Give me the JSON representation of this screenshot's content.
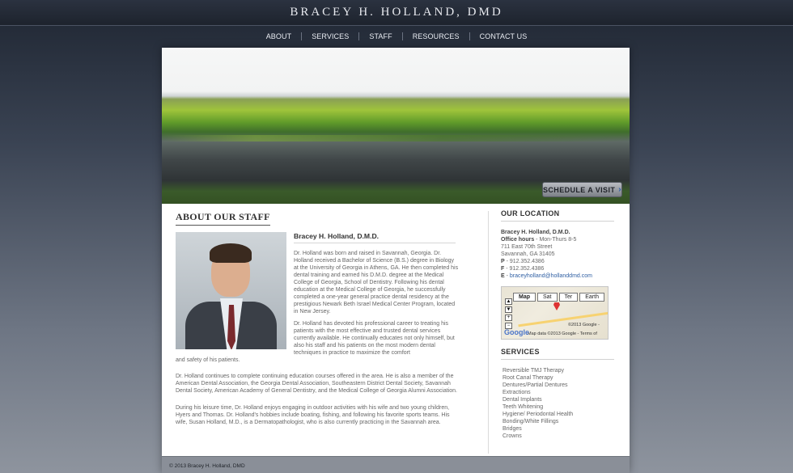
{
  "header": {
    "title": "BRACEY H. HOLLAND, DMD"
  },
  "nav": {
    "items": [
      "ABOUT",
      "SERVICES",
      "STAFF",
      "RESOURCES",
      "CONTACT US"
    ]
  },
  "hero": {
    "schedule_label": "SCHEDULE A VISIT"
  },
  "about": {
    "section_title": "ABOUT OUR STAFF",
    "doctor_name": "Bracey H. Holland, D.M.D.",
    "bio1": "Dr. Holland was born and raised in Savannah, Georgia. Dr. Holland received a Bachelor of Science (B.S.) degree in Biology at the University of Georgia in Athens, GA. He then completed his dental training and earned his D.M.D. degree at the Medical College of Georgia, School of Dentistry. Following his dental education at the Medical College of Georgia, he successfully completed a one-year general practice dental residency at the prestigious Newark Beth Israel Medical Center Program, located in New Jersey.",
    "bio2": "Dr. Holland has devoted his professional career to treating his patients with the most effective and trusted dental services currently available. He continually educates not only himself, but also his staff and his patients on the most modern dental techniques in practice to maximize the comfort",
    "bio2_tail": "and safety of his patients.",
    "bio3": "Dr. Holland continues to complete continuing education courses offered in the area. He is also a member of the American Dental Association, the Georgia Dental Association, Southeastern District Dental Society, Savannah Dental Society, American Academy of General Dentistry, and the Medical College of Georgia Alumni Association.",
    "bio4": "During his leisure time, Dr. Holland enjoys engaging in outdoor activities with his wife and two young children, Hyers and Thomas. Dr. Holland's hobbies include boating, fishing, and following his favorite sports teams. His wife, Susan Holland, M.D., is a Dermatopathologist, who is also currently practicing in the Savannah area."
  },
  "location": {
    "title": "OUR LOCATION",
    "name": "Bracey H. Holland, D.M.D.",
    "hours_label": "Office hours",
    "hours_value": " - Mon-Thurs 8-5",
    "street": "711 East 70th Street",
    "city": "Savannah, GA 31405",
    "phone_label": "P",
    "phone": " - 912.352.4386",
    "fax_label": "F",
    "fax": " - 912.352.4386",
    "email_label": "E",
    "email": "braceyholland@hollanddmd.com",
    "map": {
      "tabs": [
        "Map",
        "Sat",
        "Ter",
        "Earth"
      ],
      "copyright1": "©2013 Google -",
      "copyright2": "Map data ©2013 Google - Terms of",
      "logo": "Google"
    }
  },
  "services": {
    "title": "SERVICES",
    "items": [
      "Reversible TMJ Therapy",
      "Root Canal Therapy",
      "Dentures/Partial Dentures",
      "Extractions",
      "Dental Implants",
      "Teeth Whitening",
      "Hygiene/ Periodontal Health",
      "Bonding/White Fillings",
      "Bridges",
      "Crowns"
    ]
  },
  "footer": {
    "copyright": "© 2013 Bracey H. Holland, DMD"
  }
}
